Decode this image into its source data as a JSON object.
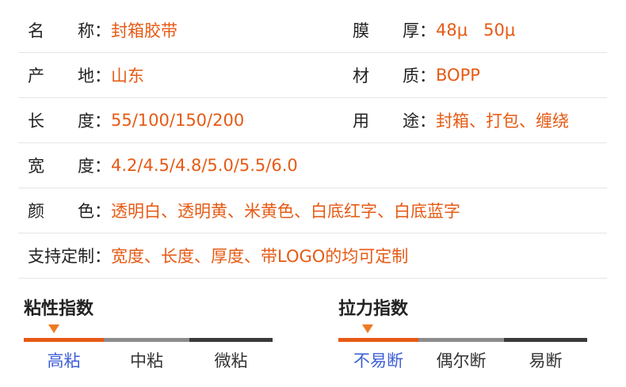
{
  "specs": {
    "row1": {
      "left": {
        "label_a": "名",
        "label_b": "称",
        "value": "封箱胶带"
      },
      "right": {
        "label_a": "膜",
        "label_b": "厚",
        "value": "48μ   50μ"
      }
    },
    "row2": {
      "left": {
        "label_a": "产",
        "label_b": "地",
        "value": "山东"
      },
      "right": {
        "label_a": "材",
        "label_b": "质",
        "value": "BOPP"
      }
    },
    "row3": {
      "left": {
        "label_a": "长",
        "label_b": "度",
        "value": "55/100/150/200"
      },
      "right": {
        "label_a": "用",
        "label_b": "途",
        "value": "封箱、打包、缠绕"
      }
    },
    "row4": {
      "left": {
        "label_a": "宽",
        "label_b": "度",
        "value": "4.2/4.5/4.8/5.0/5.5/6.0"
      }
    },
    "row5": {
      "left": {
        "label_a": "颜",
        "label_b": "色",
        "value": "透明白、透明黄、米黄色、白底红字、白底蓝字"
      }
    },
    "row6": {
      "left": {
        "label": "支持定制",
        "value": "宽度、长度、厚度、带LOGO的均可定制"
      }
    },
    "colon": "："
  },
  "stickiness": {
    "title": "粘性指数",
    "levels": [
      "高粘",
      "中粘",
      "微粘"
    ],
    "selected_index": 0,
    "accent_color": "#e65a14",
    "active_label_color": "#3d5fd6"
  },
  "tensile": {
    "title": "拉力指数",
    "levels": [
      "不易断",
      "偶尔断",
      "易断"
    ],
    "selected_index": 0,
    "accent_color": "#e65a14",
    "active_label_color": "#3d5fd6"
  }
}
